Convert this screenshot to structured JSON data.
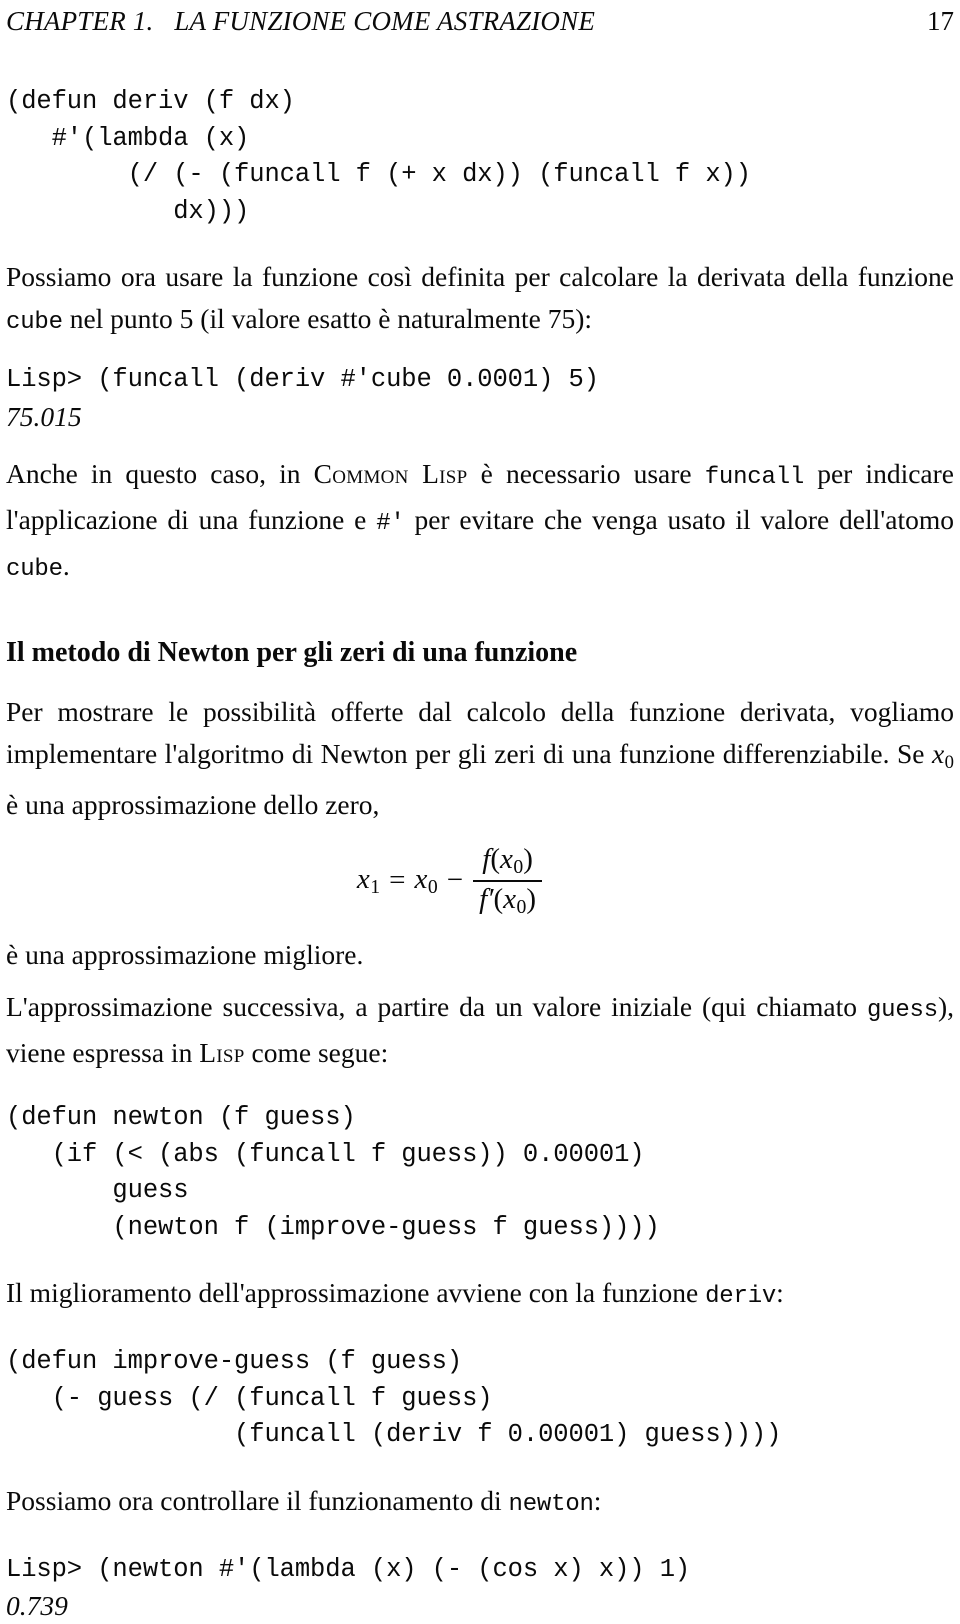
{
  "running_head": {
    "chapter_title": "CHAPTER 1.   LA FUNZIONE COME ASTRAZIONE",
    "page_number": "17"
  },
  "code_deriv": "(defun deriv (f dx)\n   #'(lambda (x)\n        (/ (- (funcall f (+ x dx)) (funcall f x))\n           dx)))",
  "para_possiamo": {
    "part1": "Possiamo ora usare la funzione così definita per calcolare la derivata della funzione ",
    "code1": "cube",
    "part2": " nel punto 5 (il valore esatto è naturalmente 75):"
  },
  "repl_deriv": {
    "input": "Lisp> (funcall (deriv #'cube 0.0001) 5)",
    "output": "75.015"
  },
  "para_anche": {
    "part1": "Anche in questo caso, in ",
    "smallcaps": "Common Lisp",
    "part2": " è necessario usare ",
    "code1": "funcall",
    "part3": " per indicare l'applicazione di una funzione e ",
    "code2": "#'",
    "part4": " per evitare che venga usato il valore dell'atomo ",
    "code3": "cube",
    "part5": "."
  },
  "heading_newton": "Il metodo di Newton per gli zeri di una funzione",
  "para_per_mostrare": {
    "part1": "Per mostrare le possibilità offerte dal calcolo della funzione derivata, vogliamo implementare l'algoritmo di Newton per gli zeri di una funzione differenziabile. Se ",
    "math_var": "x",
    "math_sub": "0",
    "part2": " è una approssimazione dello zero,"
  },
  "equation": {
    "lhs_var": "x",
    "lhs_sub": "1",
    "relation": "=",
    "rhs_var": "x",
    "rhs_sub": "0",
    "operator": "−",
    "numerator_fn": "f",
    "numerator_arg_var": "x",
    "numerator_arg_sub": "0",
    "denominator_fn": "f",
    "denominator_prime": "′",
    "denominator_arg_var": "x",
    "denominator_arg_sub": "0",
    "open_paren": "(",
    "close_paren": ")"
  },
  "para_migliore": "è una approssimazione migliore.",
  "para_successiva": {
    "part1": "L'approssimazione successiva, a partire da un valore iniziale (qui chiamato ",
    "code1": "guess",
    "part2": "), viene espressa in ",
    "smallcaps": "Lisp",
    "part3": " come segue:"
  },
  "code_newton": "(defun newton (f guess)\n   (if (< (abs (funcall f guess)) 0.00001)\n       guess\n       (newton f (improve-guess f guess))))",
  "para_miglioramento": {
    "part1": "Il miglioramento dell'approssimazione avviene con la funzione ",
    "code1": "deriv",
    "part2": ":"
  },
  "code_improve": "(defun improve-guess (f guess)\n   (- guess (/ (funcall f guess)\n               (funcall (deriv f 0.00001) guess))))",
  "para_controllare": {
    "part1": "Possiamo ora controllare il funzionamento di ",
    "code1": "newton",
    "part2": ":"
  },
  "repl_newton": {
    "input": "Lisp> (newton #'(lambda (x) (- (cos x) x)) 1)",
    "output": "0.739"
  }
}
